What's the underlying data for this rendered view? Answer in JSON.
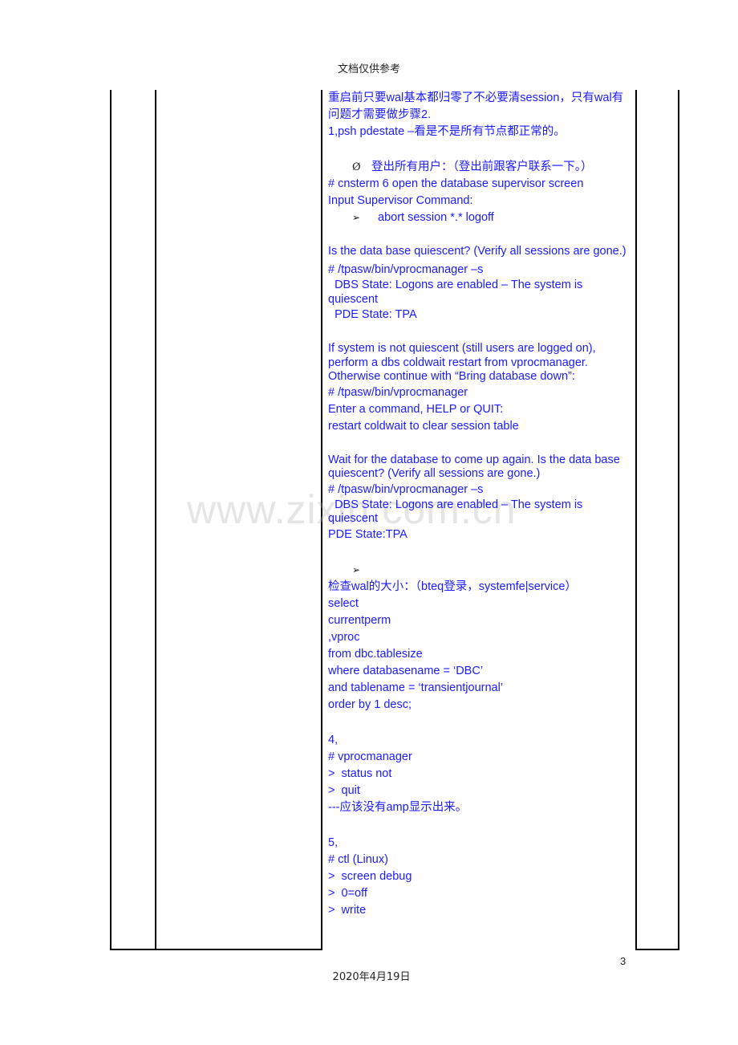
{
  "header": {
    "text": "文档仅供参考"
  },
  "watermark": {
    "text": "www.zixin.com.cn"
  },
  "content": {
    "p1": "重启前只要wal基本都归零了不必要清session，只有wal有问题才需要做步骤2.",
    "p2": "1,psh pdestate –看是不是所有节点都正常的。",
    "logout_bullet": "Ø",
    "logout_text": "登出所有用户：（登出前跟客户联系一下。）",
    "cnsterm": "# cnsterm 6 open the database supervisor screen",
    "input_supervisor": "Input Supervisor Command:",
    "arrow_bullet": "➢",
    "abort_session": "abort session *.* logoff",
    "quiescent_q1": "Is the data base quiescent? (Verify all sessions are gone.)",
    "vproc_s_1": "# /tpasw/bin/vprocmanager –s",
    "dbs_state_1": "  DBS State: Logons are enabled – The system is quiescent",
    "pde_state_1": "  PDE State: TPA",
    "not_quiescent": "If system is not quiescent (still users are logged on), perform a dbs coldwait restart from vprocmanager. Otherwise continue with “Bring database down”:",
    "vproc_2": "# /tpasw/bin/vprocmanager",
    "enter_command": "Enter a command, HELP or QUIT:",
    "restart_coldwait": "restart coldwait to clear session table",
    "wait_db": "Wait for the database to come up again. Is the data base quiescent? (Verify all sessions are gone.)",
    "vproc_s_2": "# /tpasw/bin/vprocmanager –s",
    "dbs_state_2": "  DBS State: Logons are enabled – The system is quiescent",
    "pde_state_2": "PDE State:TPA",
    "arrow_bullet_2": "➢",
    "check_wal": "检查wal的大小：（bteq登录，systemfe|service）",
    "sql": [
      "select",
      "currentperm",
      ",vproc",
      "from dbc.tablesize",
      "where databasename = ‘DBC’",
      "and tablename = ‘transientjournal’",
      "order by 1 desc;"
    ],
    "step4": [
      "4,",
      "# vprocmanager",
      ">  status not",
      ">  quit",
      "---应该没有amp显示出来。"
    ],
    "step5": [
      "5,",
      "# ctl (Linux)",
      ">  screen debug",
      ">  0=off",
      ">  write"
    ]
  },
  "footer": {
    "page_number": "3",
    "date": "2020年4月19日"
  }
}
